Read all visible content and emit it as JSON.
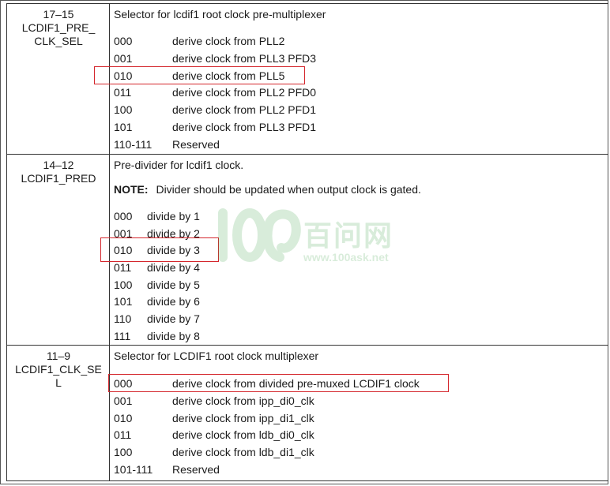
{
  "watermark": {
    "logo": "100",
    "brand": "百问网",
    "url": "www.100ask.net",
    "color": "#2e9a3a"
  },
  "highlight_color": "#d4262c",
  "fields": [
    {
      "bits": "17–15",
      "name_lines": [
        "LCDIF1_PRE_",
        "CLK_SEL"
      ],
      "description": "Selector for lcdif1 root clock pre-multiplexer",
      "options": [
        {
          "code": "000",
          "text": "derive clock from PLL2"
        },
        {
          "code": "001",
          "text": "derive clock from PLL3 PFD3"
        },
        {
          "code": "010",
          "text": "derive clock from PLL5"
        },
        {
          "code": "011",
          "text": "derive clock from PLL2 PFD0"
        },
        {
          "code": "100",
          "text": "derive clock from PLL2 PFD1"
        },
        {
          "code": "101",
          "text": "derive clock from PLL3 PFD1"
        },
        {
          "code": "110-111",
          "text": "Reserved"
        }
      ]
    },
    {
      "bits": "14–12",
      "name_lines": [
        "LCDIF1_PRED"
      ],
      "description": "Pre-divider for lcdif1 clock.",
      "note_label": "NOTE:",
      "note_text": "Divider should be updated when output clock is gated.",
      "options": [
        {
          "code": "000",
          "text": "divide by 1"
        },
        {
          "code": "001",
          "text": "divide by 2"
        },
        {
          "code": "010",
          "text": "divide by 3"
        },
        {
          "code": "011",
          "text": "divide by 4"
        },
        {
          "code": "100",
          "text": "divide by 5"
        },
        {
          "code": "101",
          "text": "divide by 6"
        },
        {
          "code": "110",
          "text": "divide by 7"
        },
        {
          "code": "111",
          "text": "divide by 8"
        }
      ]
    },
    {
      "bits": "11–9",
      "name_lines": [
        "LCDIF1_CLK_SE",
        "L"
      ],
      "description": "Selector for LCDIF1 root clock multiplexer",
      "options": [
        {
          "code": "000",
          "text": "derive clock from divided pre-muxed LCDIF1 clock"
        },
        {
          "code": "001",
          "text": "derive clock from ipp_di0_clk"
        },
        {
          "code": "010",
          "text": "derive clock from ipp_di1_clk"
        },
        {
          "code": "011",
          "text": "derive clock from ldb_di0_clk"
        },
        {
          "code": "100",
          "text": "derive clock from ldb_di1_clk"
        },
        {
          "code": "101-111",
          "text": "Reserved"
        }
      ]
    }
  ]
}
